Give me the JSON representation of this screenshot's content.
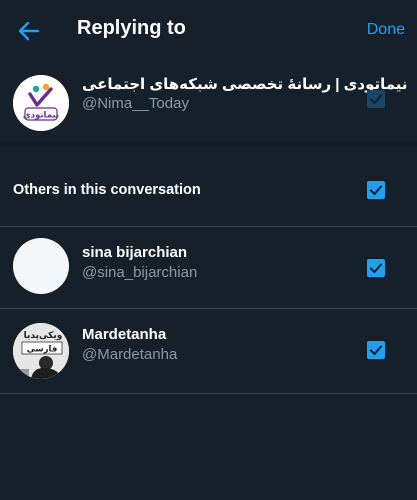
{
  "header": {
    "title": "Replying to",
    "done_label": "Done"
  },
  "primary": {
    "name": "نیماتودی | رسانهٔ تخصصی شبکه‌های اجتماعی",
    "handle": "@Nima__Today",
    "avatar_text": "نیماتودی",
    "checked": true
  },
  "others": {
    "label": "Others in this conversation",
    "checked": true
  },
  "users": [
    {
      "name": "sina bijarchian",
      "handle": "@sina_bijarchian",
      "checked": true
    },
    {
      "name": "Mardetanha",
      "handle": "@Mardetanha",
      "avatar_text_top": "ویکی‌پدیا",
      "avatar_text_bottom": "فارسی",
      "checked": true
    }
  ],
  "colors": {
    "background": "#15202b",
    "accent": "#1da1f2",
    "secondary_text": "#8899a6"
  }
}
